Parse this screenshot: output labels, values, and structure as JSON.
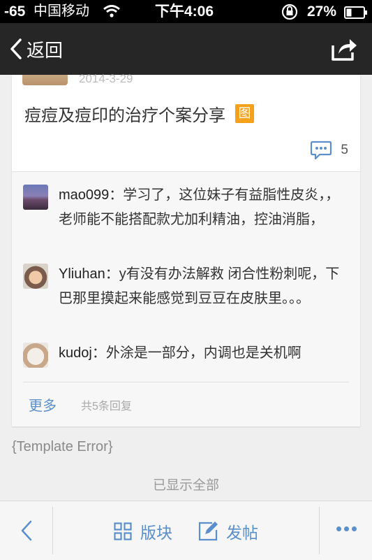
{
  "status_bar": {
    "signal": "-65",
    "carrier": "中国移动",
    "time": "下午4:06",
    "battery": "27%"
  },
  "nav": {
    "back_label": "返回",
    "share_icon": "share-icon"
  },
  "post": {
    "date": "2014-3-29",
    "title": "痘痘及痘印的治疗个案分享",
    "image_badge": "图",
    "comment_count": "5"
  },
  "replies": [
    {
      "user": "mao099",
      "separator": "：",
      "text": "学习了，这位妹子有益脂性皮炎，，老师能不能搭配款尤加利精油，控油消脂，"
    },
    {
      "user": "Yliuhan",
      "separator": "：",
      "text": "y有没有办法解救 闭合性粉刺呢，下巴那里摸起来能感觉到豆豆在皮肤里。。。"
    },
    {
      "user": "kudoj",
      "separator": "：",
      "text": "外涂是一部分，内调也是关机啊"
    }
  ],
  "replies_footer": {
    "more_label": "更多",
    "total": "共5条回复"
  },
  "template_error": "{Template Error}",
  "shown_all": "已显示全部",
  "toolbar": {
    "boards_label": "版块",
    "post_label": "发帖"
  },
  "colors": {
    "accent": "#5a8fcb",
    "badge": "#f5a11c",
    "nav_bg": "#262626"
  }
}
